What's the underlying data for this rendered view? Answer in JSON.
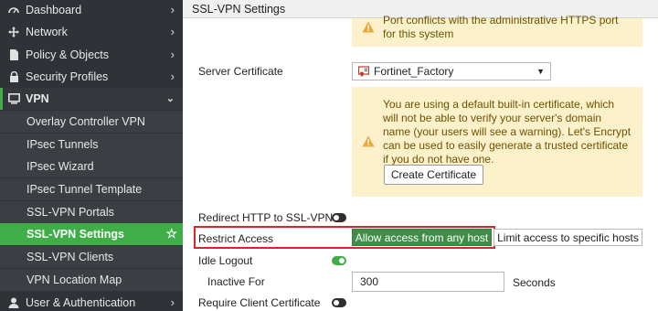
{
  "sidebar": {
    "items": [
      {
        "label": "Dashboard",
        "icon": "dashboard-icon"
      },
      {
        "label": "Network",
        "icon": "network-icon"
      },
      {
        "label": "Policy & Objects",
        "icon": "policy-icon"
      },
      {
        "label": "Security Profiles",
        "icon": "lock-icon"
      },
      {
        "label": "VPN",
        "icon": "monitor-icon"
      },
      {
        "label": "Overlay Controller VPN"
      },
      {
        "label": "IPsec Tunnels"
      },
      {
        "label": "IPsec Wizard"
      },
      {
        "label": "IPsec Tunnel Template"
      },
      {
        "label": "SSL-VPN Portals"
      },
      {
        "label": "SSL-VPN Settings"
      },
      {
        "label": "SSL-VPN Clients"
      },
      {
        "label": "VPN Location Map"
      },
      {
        "label": "User & Authentication",
        "icon": "user-icon"
      }
    ]
  },
  "panel": {
    "title": "SSL-VPN Settings"
  },
  "warnings": {
    "port_conflict": {
      "line1": "Port conflicts with the administrative HTTPS port",
      "line2": "for this system"
    },
    "default_cert": {
      "lines": [
        "You are using a default built-in certificate, which",
        "will not be able to verify your server's domain",
        "name (your users will see a warning). Let's Encrypt",
        "can be used to easily generate a trusted certificate",
        "if you do not have one."
      ]
    }
  },
  "form": {
    "server_certificate": {
      "label": "Server Certificate",
      "value": "Fortinet_Factory"
    },
    "create_certificate_button": "Create Certificate",
    "redirect_http": {
      "label": "Redirect HTTP to SSL-VPN",
      "enabled": false
    },
    "restrict_access": {
      "label": "Restrict Access",
      "options": [
        "Allow access from any host",
        "Limit access to specific hosts"
      ],
      "selected": "Allow access from any host"
    },
    "idle_logout": {
      "label": "Idle Logout",
      "enabled": true
    },
    "inactive_for": {
      "label": "Inactive For",
      "value": "300",
      "unit": "Seconds"
    },
    "require_client_cert": {
      "label": "Require Client Certificate",
      "enabled": false
    }
  },
  "colors": {
    "sidebar_bg": "#2f3337",
    "accent_green": "#3fae49",
    "warning_bg": "#fdf1cb",
    "highlight_red": "#d9262b"
  }
}
